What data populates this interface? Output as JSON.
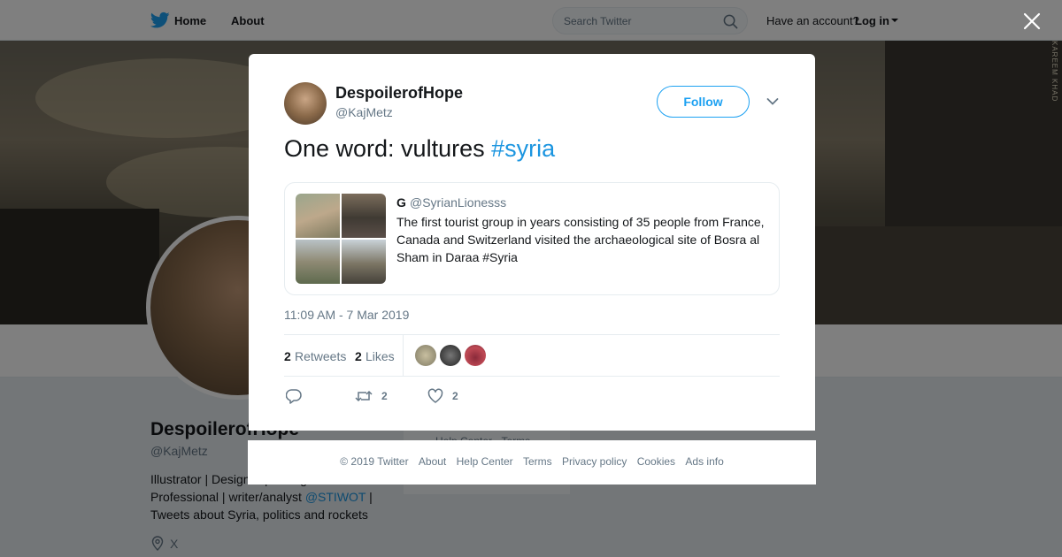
{
  "nav": {
    "home_label": "Home",
    "about_label": "About",
    "search_placeholder": "Search Twitter",
    "have_account": "Have an account?",
    "login_label": "Log in"
  },
  "banner": {
    "watermark": "KAREEM KHAD"
  },
  "profile": {
    "name": "DespoilerofHope",
    "handle": "@KajMetz",
    "bio_line1": "Illustrator | Designer | Intelligence",
    "bio_line2_prefix": "Professional | writer/analyst ",
    "bio_link": "@STIWOT",
    "bio_line2_suffix": " |",
    "bio_line3": "Tweets about Syria, politics and rockets",
    "location": "X",
    "side_card_text": "Help Center · Terms"
  },
  "tweet": {
    "author_name": "DespoilerofHope",
    "author_handle": "@KajMetz",
    "follow_label": "Follow",
    "text_prefix": "One word: vultures ",
    "hashtag": "#syria",
    "timestamp": "11:09 AM - 7 Mar 2019",
    "retweets_count": "2",
    "retweets_label": "Retweets",
    "likes_count": "2",
    "likes_label": "Likes",
    "action_retweet_count": "2",
    "action_like_count": "2"
  },
  "quote": {
    "name": "G",
    "handle": "@SyrianLionesss",
    "text": "The first tourist group in years consisting of 35 people from France, Canada and Switzerland visited the archaeological site of Bosra al Sham in Daraa #Syria"
  },
  "footer": {
    "links": [
      "© 2019 Twitter",
      "About",
      "Help Center",
      "Terms",
      "Privacy policy",
      "Cookies",
      "Ads info"
    ]
  },
  "colors": {
    "accent": "#1da1f2",
    "link": "#1b95e0",
    "muted": "#657786"
  }
}
